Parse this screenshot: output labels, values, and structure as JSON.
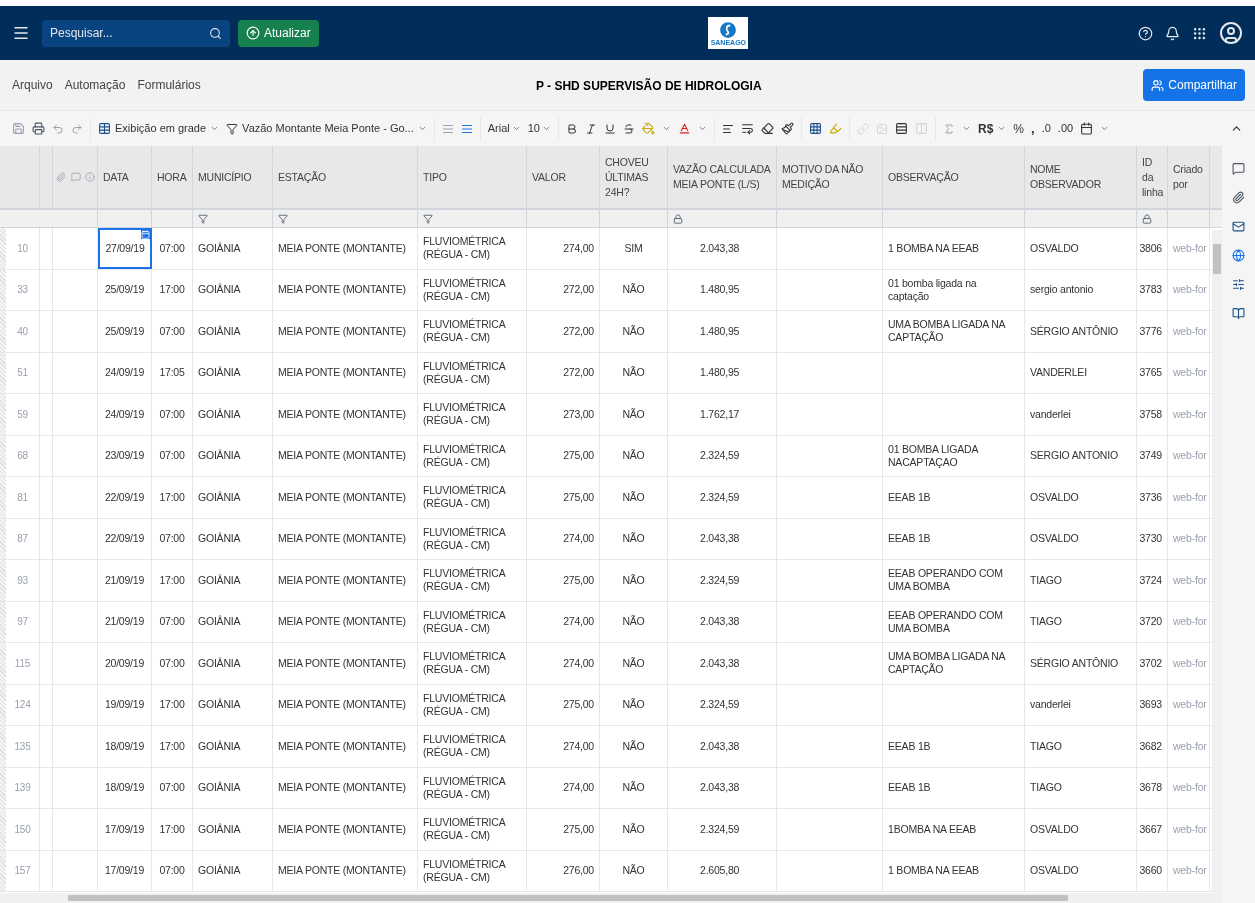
{
  "header": {
    "search": {
      "placeholder": "Pesquisar..."
    },
    "update_button": "Atualizar",
    "logo_text": "SANEAGO"
  },
  "menu": {
    "items": [
      "Arquivo",
      "Automação",
      "Formulários"
    ],
    "title": "P - SHD SUPERVISÃO DE HIDROLOGIA",
    "share_button": "Compartilhar"
  },
  "toolbar": {
    "view_dropdown": "Exibição em grade",
    "filter_dropdown": "Vazão Montante Meia Ponte - Go...",
    "font_dropdown": "Arial",
    "size_dropdown": "10",
    "currency_button": "R$",
    "percent_button": "%",
    "comma_button": ",",
    "decimal_buttons": [
      ".0",
      ".00"
    ]
  },
  "table": {
    "columns": [
      {
        "label": "DATA",
        "filter": false,
        "locked": false
      },
      {
        "label": "HORA",
        "filter": false,
        "locked": false
      },
      {
        "label": "MUNICÍPIO",
        "filter": true,
        "locked": false
      },
      {
        "label": "ESTAÇÃO",
        "filter": true,
        "locked": false
      },
      {
        "label": "TIPO",
        "filter": true,
        "locked": false
      },
      {
        "label": "VALOR",
        "filter": false,
        "locked": false
      },
      {
        "label": "CHOVEU ÚLTIMAS 24H?",
        "filter": false,
        "locked": false
      },
      {
        "label": "VAZÃO CALCULADA MEIA PONTE (L/S)",
        "filter": false,
        "locked": true
      },
      {
        "label": "MOTIVO DA NÃO MEDIÇÃO",
        "filter": false,
        "locked": false
      },
      {
        "label": "OBSERVAÇÃO",
        "filter": false,
        "locked": false
      },
      {
        "label": "NOME OBSERVADOR",
        "filter": false,
        "locked": false
      },
      {
        "label": "ID da linha",
        "filter": false,
        "locked": true
      },
      {
        "label": "Criado por",
        "filter": false,
        "locked": false
      }
    ],
    "rows": [
      {
        "number": "10",
        "date_selected": true,
        "date": "27/09/19",
        "time": "07:00",
        "municipality": "GOIÂNIA",
        "station": "MEIA PONTE (MONTANTE)",
        "type": "FLUVIOMÉTRICA (RÉGUA - CM)",
        "value": "274,00",
        "rained": "SIM",
        "flow": "2.043,38",
        "observation": "1 BOMBA NA EEAB",
        "observer": "OSVALDO",
        "id": "3806",
        "created_by": "web-for"
      },
      {
        "number": "33",
        "date_selected": false,
        "date": "25/09/19",
        "time": "17:00",
        "municipality": "GOIÂNIA",
        "station": "MEIA PONTE (MONTANTE)",
        "type": "FLUVIOMÉTRICA (RÉGUA - CM)",
        "value": "272,00",
        "rained": "NÃO",
        "flow": "1.480,95",
        "observation": "01 bomba ligada na captação",
        "observer": "sergio antonio",
        "id": "3783",
        "created_by": "web-for"
      },
      {
        "number": "40",
        "date_selected": false,
        "date": "25/09/19",
        "time": "07:00",
        "municipality": "GOIÂNIA",
        "station": "MEIA PONTE (MONTANTE)",
        "type": "FLUVIOMÉTRICA (RÉGUA - CM)",
        "value": "272,00",
        "rained": "NÃO",
        "flow": "1.480,95",
        "observation": "UMA BOMBA LIGADA NA CAPTAÇÃO",
        "observer": "SÉRGIO ANTÔNIO",
        "id": "3776",
        "created_by": "web-for"
      },
      {
        "number": "51",
        "date_selected": false,
        "date": "24/09/19",
        "time": "17:05",
        "municipality": "GOIÂNIA",
        "station": "MEIA PONTE (MONTANTE)",
        "type": "FLUVIOMÉTRICA (RÉGUA - CM)",
        "value": "272,00",
        "rained": "NÃO",
        "flow": "1.480,95",
        "observer": "VANDERLEI",
        "id": "3765",
        "created_by": "web-for"
      },
      {
        "number": "59",
        "date_selected": false,
        "date": "24/09/19",
        "time": "07:00",
        "municipality": "GOIÂNIA",
        "station": "MEIA PONTE (MONTANTE)",
        "type": "FLUVIOMÉTRICA (RÉGUA - CM)",
        "value": "273,00",
        "rained": "NÃO",
        "flow": "1.762,17",
        "observer": "vanderlei",
        "id": "3758",
        "created_by": "web-for"
      },
      {
        "number": "68",
        "date_selected": false,
        "date": "23/09/19",
        "time": "07:00",
        "municipality": "GOIÂNIA",
        "station": "MEIA PONTE (MONTANTE)",
        "type": "FLUVIOMÉTRICA (RÉGUA - CM)",
        "value": "275,00",
        "rained": "NÃO",
        "flow": "2.324,59",
        "observation": "01 BOMBA LIGADA NACAPTAÇAO",
        "observer": "SERGIO ANTONIO",
        "id": "3749",
        "created_by": "web-for"
      },
      {
        "number": "81",
        "date_selected": false,
        "date": "22/09/19",
        "time": "17:00",
        "municipality": "GOIÂNIA",
        "station": "MEIA PONTE (MONTANTE)",
        "type": "FLUVIOMÉTRICA (RÉGUA - CM)",
        "value": "275,00",
        "rained": "NÃO",
        "flow": "2.324,59",
        "observation": "EEAB 1B",
        "observer": "OSVALDO",
        "id": "3736",
        "created_by": "web-for"
      },
      {
        "number": "87",
        "date_selected": false,
        "date": "22/09/19",
        "time": "07:00",
        "municipality": "GOIÂNIA",
        "station": "MEIA PONTE (MONTANTE)",
        "type": "FLUVIOMÉTRICA (RÉGUA - CM)",
        "value": "274,00",
        "rained": "NÃO",
        "flow": "2.043,38",
        "observation": "EEAB 1B",
        "observer": "OSVALDO",
        "id": "3730",
        "created_by": "web-for"
      },
      {
        "number": "93",
        "date_selected": false,
        "date": "21/09/19",
        "time": "17:00",
        "municipality": "GOIÂNIA",
        "station": "MEIA PONTE (MONTANTE)",
        "type": "FLUVIOMÉTRICA (RÉGUA - CM)",
        "value": "275,00",
        "rained": "NÃO",
        "flow": "2.324,59",
        "observation": "EEAB OPERANDO COM UMA BOMBA",
        "observer": "TIAGO",
        "id": "3724",
        "created_by": "web-for"
      },
      {
        "number": "97",
        "date_selected": false,
        "date": "21/09/19",
        "time": "07:00",
        "municipality": "GOIÂNIA",
        "station": "MEIA PONTE (MONTANTE)",
        "type": "FLUVIOMÉTRICA (RÉGUA - CM)",
        "value": "274,00",
        "rained": "NÃO",
        "flow": "2.043,38",
        "observation": "EEAB OPERANDO COM UMA BOMBA",
        "observer": "TIAGO",
        "id": "3720",
        "created_by": "web-for"
      },
      {
        "number": "115",
        "date_selected": false,
        "date": "20/09/19",
        "time": "07:00",
        "municipality": "GOIÂNIA",
        "station": "MEIA PONTE (MONTANTE)",
        "type": "FLUVIOMÉTRICA (RÉGUA - CM)",
        "value": "274,00",
        "rained": "NÃO",
        "flow": "2.043,38",
        "observation": "UMA BOMBA LIGADA NA CAPTAÇÃO",
        "observer": "SÉRGIO ANTÔNIO",
        "id": "3702",
        "created_by": "web-for"
      },
      {
        "number": "124",
        "date_selected": false,
        "date": "19/09/19",
        "time": "17:00",
        "municipality": "GOIÂNIA",
        "station": "MEIA PONTE (MONTANTE)",
        "type": "FLUVIOMÉTRICA (RÉGUA - CM)",
        "value": "275,00",
        "rained": "NÃO",
        "flow": "2.324,59",
        "observer": "vanderlei",
        "id": "3693",
        "created_by": "web-for"
      },
      {
        "number": "135",
        "date_selected": false,
        "date": "18/09/19",
        "time": "17:00",
        "municipality": "GOIÂNIA",
        "station": "MEIA PONTE (MONTANTE)",
        "type": "FLUVIOMÉTRICA (RÉGUA - CM)",
        "value": "274,00",
        "rained": "NÃO",
        "flow": "2.043,38",
        "observation": "EEAB 1B",
        "observer": "TIAGO",
        "id": "3682",
        "created_by": "web-for"
      },
      {
        "number": "139",
        "date_selected": false,
        "date": "18/09/19",
        "time": "07:00",
        "municipality": "GOIÂNIA",
        "station": "MEIA PONTE (MONTANTE)",
        "type": "FLUVIOMÉTRICA (RÉGUA - CM)",
        "value": "274,00",
        "rained": "NÃO",
        "flow": "2.043,38",
        "observation": "EEAB 1B",
        "observer": "TIAGO",
        "id": "3678",
        "created_by": "web-for"
      },
      {
        "number": "150",
        "date_selected": false,
        "date": "17/09/19",
        "time": "17:00",
        "municipality": "GOIÂNIA",
        "station": "MEIA PONTE (MONTANTE)",
        "type": "FLUVIOMÉTRICA (RÉGUA - CM)",
        "value": "275,00",
        "rained": "NÃO",
        "flow": "2.324,59",
        "observation": "1BOMBA NA EEAB",
        "observer": "OSVALDO",
        "id": "3667",
        "created_by": "web-for"
      },
      {
        "number": "157",
        "date_selected": false,
        "date": "17/09/19",
        "time": "07:00",
        "municipality": "GOIÂNIA",
        "station": "MEIA PONTE (MONTANTE)",
        "type": "FLUVIOMÉTRICA (RÉGUA - CM)",
        "value": "276,00",
        "rained": "NÃO",
        "flow": "2.605,80",
        "observation": "1 BOMBA NA EEAB",
        "observer": "OSVALDO",
        "id": "3660",
        "created_by": "web-for"
      }
    ]
  }
}
